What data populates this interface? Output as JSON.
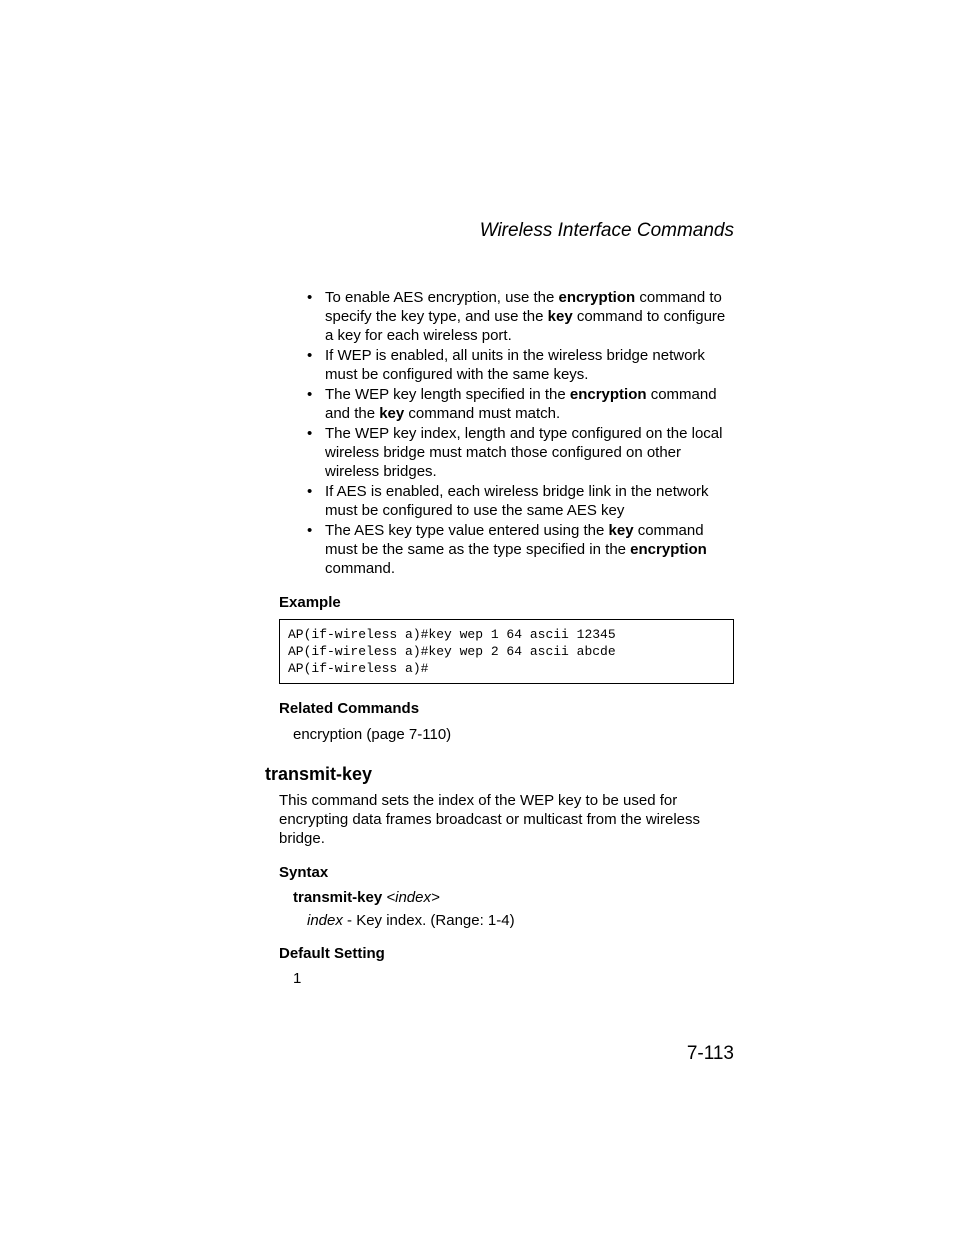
{
  "header": {
    "title": "Wireless Interface Commands"
  },
  "bullets": [
    {
      "pre": "To enable AES encryption, use the ",
      "b1": "encryption",
      "mid1": " command to specify the key type, and use the ",
      "b2": "key",
      "post": " command to configure a key for each wireless port."
    },
    {
      "pre": "If WEP is enabled, all units in the wireless bridge network must be configured with the same keys.",
      "b1": "",
      "mid1": "",
      "b2": "",
      "post": ""
    },
    {
      "pre": "The WEP key length specified in the ",
      "b1": "encryption",
      "mid1": " command and the ",
      "b2": "key",
      "post": " command must match."
    },
    {
      "pre": "The WEP key index, length and type configured on the local wireless bridge must match those configured on other wireless bridges.",
      "b1": "",
      "mid1": "",
      "b2": "",
      "post": ""
    },
    {
      "pre": "If AES is enabled, each wireless bridge link in the network must be configured to use the same AES key",
      "b1": "",
      "mid1": "",
      "b2": "",
      "post": ""
    },
    {
      "pre": "The AES key type value entered using the ",
      "b1": "key",
      "mid1": " command must be the same as the type specified in the ",
      "b2": "encryption",
      "post": " command."
    }
  ],
  "example": {
    "heading": "Example",
    "code": "AP(if-wireless a)#key wep 1 64 ascii 12345\nAP(if-wireless a)#key wep 2 64 ascii abcde\nAP(if-wireless a)#"
  },
  "related": {
    "heading": "Related Commands",
    "text": "encryption (page 7-110)"
  },
  "command": {
    "name": "transmit-key",
    "description": "This command sets the index of the WEP key to be used for encrypting data frames broadcast or multicast from the wireless bridge.",
    "syntax_heading": "Syntax",
    "syntax_cmd": "transmit-key",
    "syntax_arg": "<index>",
    "syntax_index_label": "index",
    "syntax_index_desc": " - Key index. (Range: 1-4)",
    "default_heading": "Default Setting",
    "default_value": "1"
  },
  "page_number": "7-113"
}
